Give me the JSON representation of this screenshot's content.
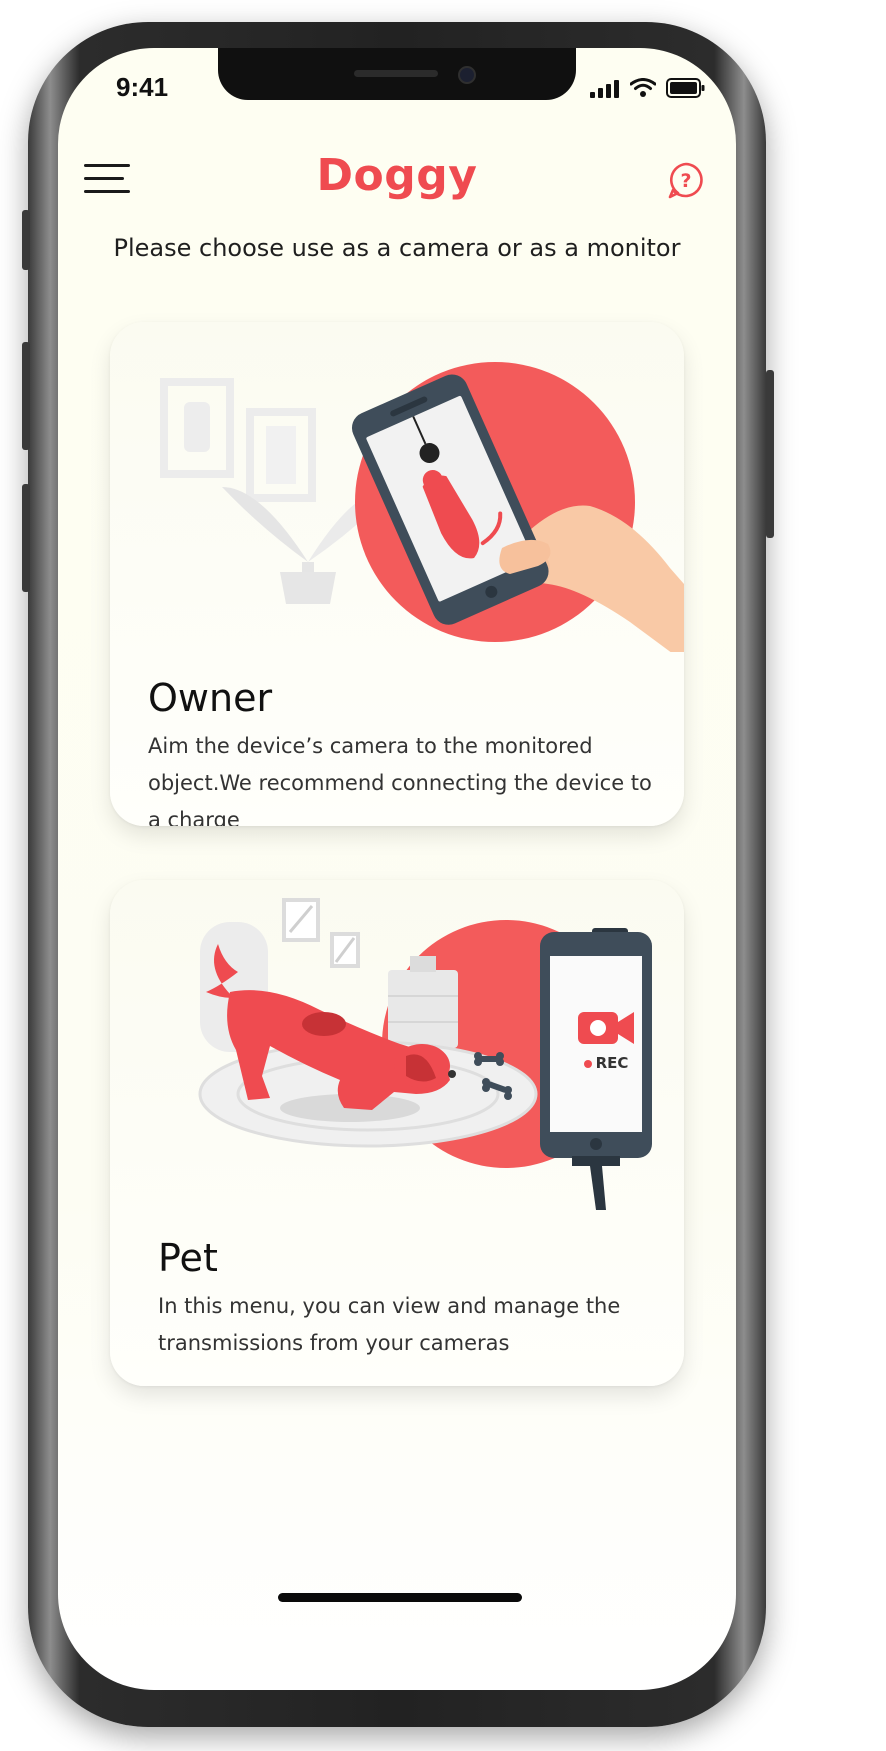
{
  "status_bar": {
    "time": "9:41"
  },
  "header": {
    "title": "Doggy"
  },
  "subtitle": "Please choose use as a camera or as a monitor",
  "cards": [
    {
      "title": "Owner",
      "description": "Aim the device’s camera to the monitored object.We recommend connecting the device to a charge"
    },
    {
      "title": "Pet",
      "description": "In this menu, you can view and manage the transmissions from your cameras",
      "rec_label": "REC"
    }
  ],
  "colors": {
    "accent": "#ef4b50",
    "background": "#fefef2",
    "phone_frame": "#222222"
  },
  "icons": [
    "menu-icon",
    "help-icon",
    "signal-icon",
    "wifi-icon",
    "battery-icon",
    "record-icon"
  ]
}
